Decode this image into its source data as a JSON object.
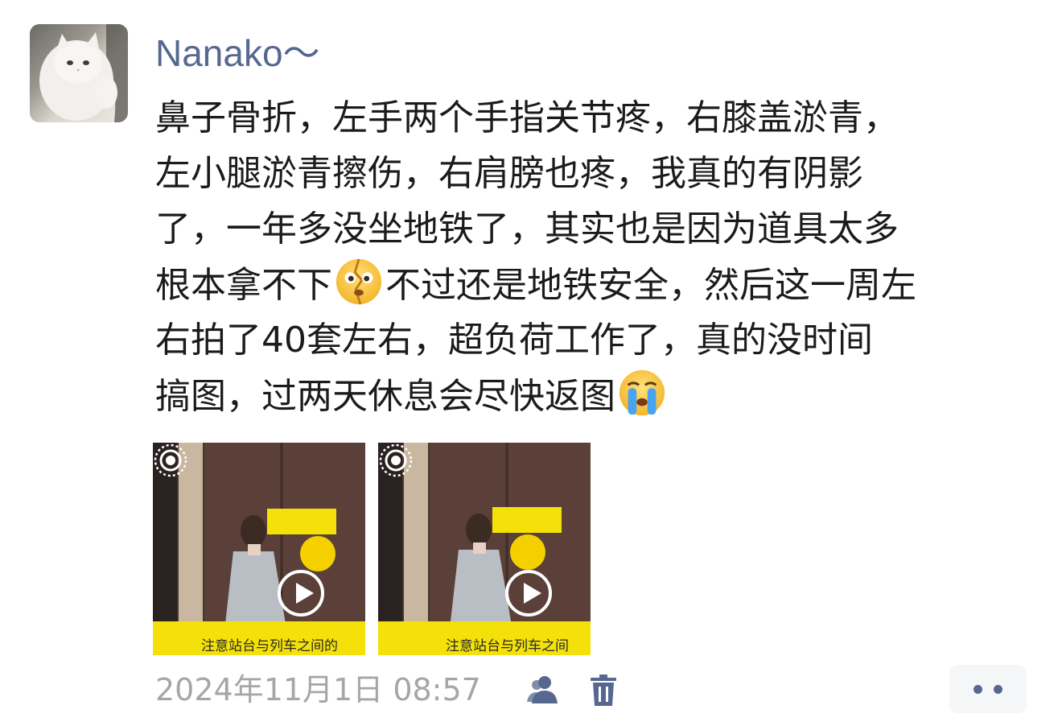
{
  "post": {
    "author": "Nanako～",
    "text_lines": [
      "鼻子骨折，左手两个手指关节疼，右膝盖淤青，",
      "左小腿淤青擦伤，右肩膀也疼，我真的有阴影",
      "了，一年多没坐地铁了，其实也是因为道具太多",
      "根本拿不下",
      "不过还是地铁安全，然后这一周左",
      "右拍了40套左右，超负荷工作了，真的没时间",
      "搞图，过两天休息会尽快返图"
    ],
    "emojis": [
      "broken-heart-face-emoji",
      "crying-face-emoji"
    ],
    "media": [
      {
        "type": "live-photo",
        "sign_text": "注意站台与列车之间的"
      },
      {
        "type": "live-photo",
        "sign_text": "注意站台与列车之间"
      }
    ],
    "timestamp": "2024年11月1日 08:57",
    "icons": [
      "visibility-people-icon",
      "trash-icon",
      "more-dots-icon"
    ]
  },
  "colors": {
    "author_name": "#56688f",
    "text": "#1b1b1b",
    "timestamp": "#a6a6a6",
    "action_bg": "#f5f6f7"
  }
}
